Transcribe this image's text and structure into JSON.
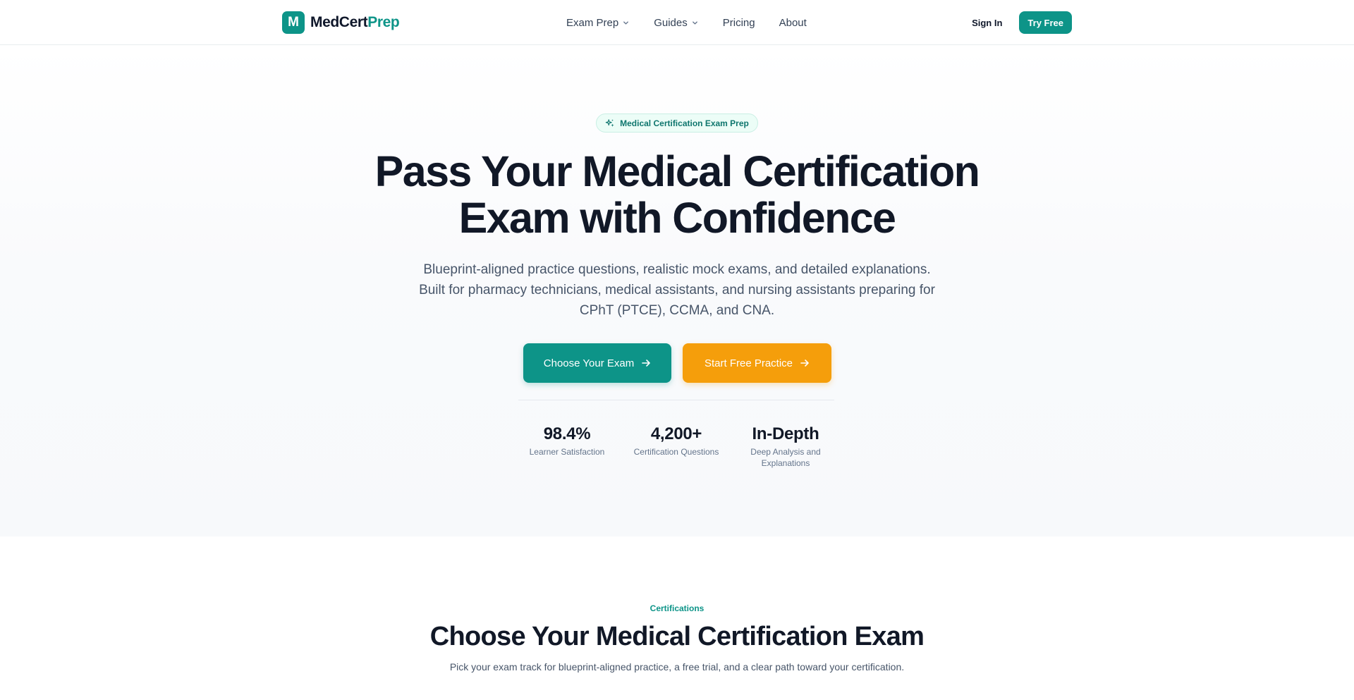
{
  "header": {
    "brand": {
      "logo_letter": "M",
      "name_main": "MedCert",
      "name_accent": "Prep"
    },
    "nav": [
      {
        "label": "Exam Prep",
        "has_dropdown": true
      },
      {
        "label": "Guides",
        "has_dropdown": true
      },
      {
        "label": "Pricing",
        "has_dropdown": false
      },
      {
        "label": "About",
        "has_dropdown": false
      }
    ],
    "sign_in_label": "Sign In",
    "try_free_label": "Try Free"
  },
  "hero": {
    "badge": "Medical Certification Exam Prep",
    "title_line1": "Pass Your Medical Certification",
    "title_line2": "Exam with Confidence",
    "subtitle": "Blueprint-aligned practice questions, realistic mock exams, and detailed explanations. Built for pharmacy technicians, medical assistants, and nursing assistants preparing for CPhT (PTCE), CCMA, and CNA.",
    "primary_cta": "Choose Your Exam",
    "secondary_cta": "Start Free Practice",
    "stats": [
      {
        "value": "98.4%",
        "label": "Learner Satisfaction"
      },
      {
        "value": "4,200+",
        "label": "Certification Questions"
      },
      {
        "value": "In-Depth",
        "label": "Deep Analysis and Explanations"
      }
    ]
  },
  "certifications": {
    "eyebrow": "Certifications",
    "title": "Choose Your Medical Certification Exam",
    "subtitle": "Pick your exam track for blueprint-aligned practice, a free trial, and a clear path toward your certification."
  },
  "icons": {
    "badge_icon": "sparkle-icon",
    "nav_dropdown_icon": "chevron-down-icon",
    "cta_icon": "arrow-right-icon"
  },
  "colors": {
    "brand_teal": "#0d9488",
    "accent_amber": "#f59e0b",
    "heading": "#111827",
    "body_text": "#475569"
  }
}
